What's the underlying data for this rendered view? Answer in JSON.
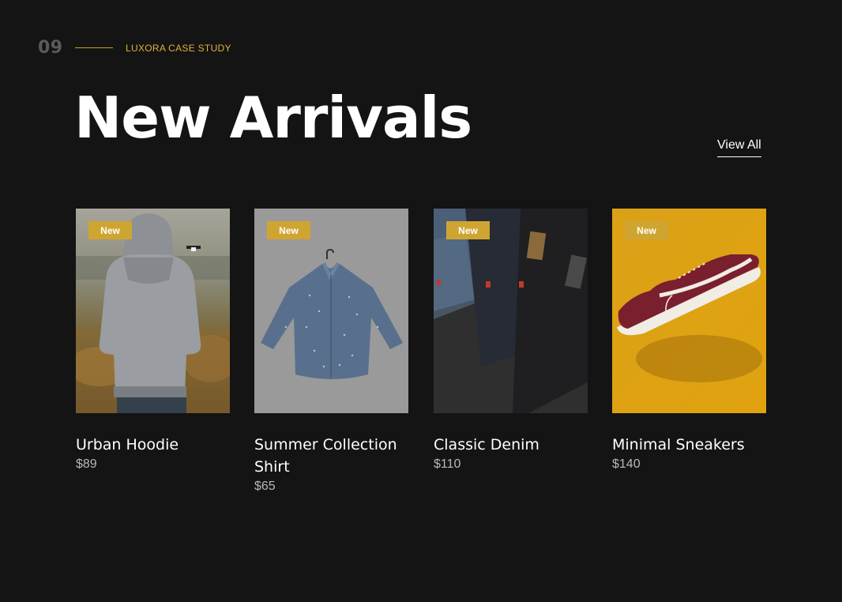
{
  "section": {
    "number": "09",
    "kicker": "LUXORA CASE STUDY"
  },
  "title": "New Arrivals",
  "view_all": "View All",
  "products": [
    {
      "badge": "New",
      "name": "Urban Hoodie",
      "price": "$89"
    },
    {
      "badge": "New",
      "name": "Summer Collection Shirt",
      "price": "$65"
    },
    {
      "badge": "New",
      "name": "Classic Denim",
      "price": "$110"
    },
    {
      "badge": "New",
      "name": "Minimal Sneakers",
      "price": "$140"
    }
  ],
  "colors": {
    "background": "#141414",
    "accent": "#cfa532",
    "kicker": "#e0b23a"
  }
}
